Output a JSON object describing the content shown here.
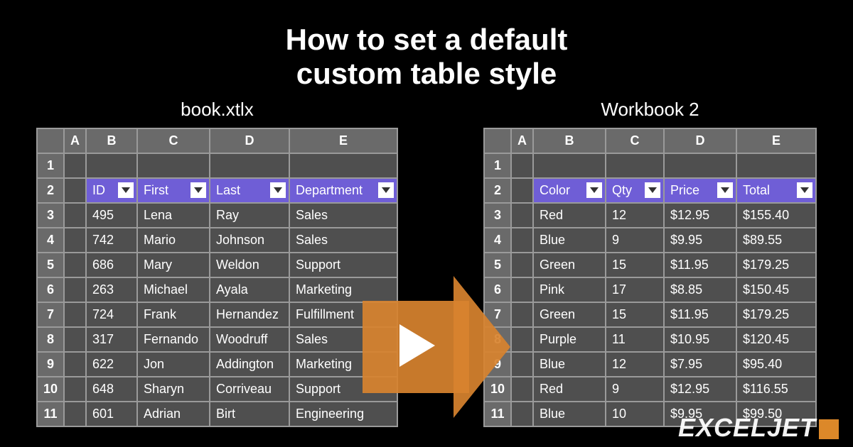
{
  "title_line1": "How to set a default",
  "title_line2": "custom table style",
  "left": {
    "sheet_title": "book.xtlx",
    "cols": [
      "A",
      "B",
      "C",
      "D",
      "E"
    ],
    "row_nums": [
      "1",
      "2",
      "3",
      "4",
      "5",
      "6",
      "7",
      "8",
      "9",
      "10",
      "11"
    ],
    "headers": [
      "ID",
      "First",
      "Last",
      "Department"
    ],
    "rows": [
      [
        "495",
        "Lena",
        "Ray",
        "Sales"
      ],
      [
        "742",
        "Mario",
        "Johnson",
        "Sales"
      ],
      [
        "686",
        "Mary",
        "Weldon",
        "Support"
      ],
      [
        "263",
        "Michael",
        "Ayala",
        "Marketing"
      ],
      [
        "724",
        "Frank",
        "Hernandez",
        "Fulfillment"
      ],
      [
        "317",
        "Fernando",
        "Woodruff",
        "Sales"
      ],
      [
        "622",
        "Jon",
        "Addington",
        "Marketing"
      ],
      [
        "648",
        "Sharyn",
        "Corriveau",
        "Support"
      ],
      [
        "601",
        "Adrian",
        "Birt",
        "Engineering"
      ]
    ]
  },
  "right": {
    "sheet_title": "Workbook 2",
    "cols": [
      "A",
      "B",
      "C",
      "D",
      "E"
    ],
    "row_nums": [
      "1",
      "2",
      "3",
      "4",
      "5",
      "6",
      "7",
      "8",
      "9",
      "10",
      "11"
    ],
    "headers": [
      "Color",
      "Qty",
      "Price",
      "Total"
    ],
    "rows": [
      [
        "Red",
        "12",
        "$12.95",
        "$155.40"
      ],
      [
        "Blue",
        "9",
        "$9.95",
        "$89.55"
      ],
      [
        "Green",
        "15",
        "$11.95",
        "$179.25"
      ],
      [
        "Pink",
        "17",
        "$8.85",
        "$150.45"
      ],
      [
        "Green",
        "15",
        "$11.95",
        "$179.25"
      ],
      [
        "Purple",
        "11",
        "$10.95",
        "$120.45"
      ],
      [
        "Blue",
        "12",
        "$7.95",
        "$95.40"
      ],
      [
        "Red",
        "9",
        "$12.95",
        "$116.55"
      ],
      [
        "Blue",
        "10",
        "$9.95",
        "$99.50"
      ]
    ]
  },
  "brand": "EXCELJET"
}
